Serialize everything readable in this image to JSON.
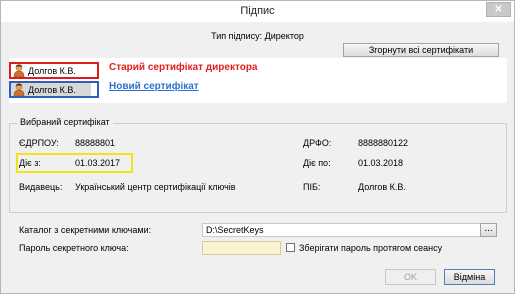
{
  "window": {
    "title": "Підпис",
    "close_glyph": "✕"
  },
  "signature_type": "Тип підпису: Директор",
  "buttons": {
    "collapse_all": "Згорнути всі сертифікати",
    "ok": "OK",
    "cancel": "Відміна",
    "browse": "..."
  },
  "certificates": [
    {
      "name": "Долгов К.В.",
      "annotation": "Старий сертифікат директора",
      "icon": "person-icon",
      "annotation_color": "#e0201c",
      "outline_color": "#dd1c1c"
    },
    {
      "name": "Долгов К.В.",
      "annotation": "Новий сертифікат",
      "icon": "person-icon",
      "annotation_color": "#2a6fd1",
      "outline_color": "#2a5fbd"
    }
  ],
  "selected_cert": {
    "group_title": "Вибраний сертифікат",
    "edrpou_label": "ЄДРПОУ:",
    "edrpou": "88888801",
    "drfo_label": "ДРФО:",
    "drfo": "8888880122",
    "valid_from_label": "Діє з:",
    "valid_from": "01.03.2017",
    "valid_to_label": "Діє по:",
    "valid_to": "01.03.2018",
    "issuer_label": "Видавець:",
    "issuer": "Український центр сертифікації ключів",
    "pib_label": "ПІБ:",
    "pib": "Долгов К.В.",
    "highlight_color": "#f2e11b"
  },
  "keys": {
    "catalog_label": "Каталог з секретними ключами:",
    "catalog_value": "D:\\SecretKeys",
    "password_label": "Пароль секретного ключа:",
    "password_value": "",
    "save_password_label": "Зберігати пароль протягом сеансу",
    "save_password_checked": false
  }
}
